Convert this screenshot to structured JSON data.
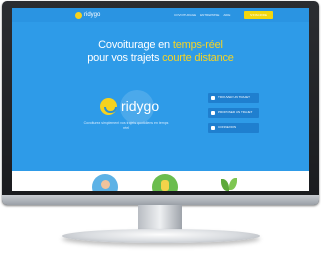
{
  "site": {
    "logo_text": "ridygo",
    "nav_links": [
      "COVOITURAGE",
      "ENTREPRISE",
      "AIDE"
    ],
    "nav_cta": "S'INSCRIRE"
  },
  "hero": {
    "title_prefix": "Covoiturage en ",
    "title_highlight_1": "temps-réel",
    "title_line2_prefix": "pour vos trajets ",
    "title_highlight_2": "courte distance"
  },
  "brand": {
    "name": "ridygo",
    "tagline": "Covoiturez simplement vos trajets quotidiens en temps réel"
  },
  "actions": [
    {
      "label": "TROUVER UN TRAJET"
    },
    {
      "label": "PROPOSER UN TRAJET"
    },
    {
      "label": "CONNEXION"
    }
  ],
  "colors": {
    "accent": "#f6d423",
    "background": "#2e9be8"
  }
}
